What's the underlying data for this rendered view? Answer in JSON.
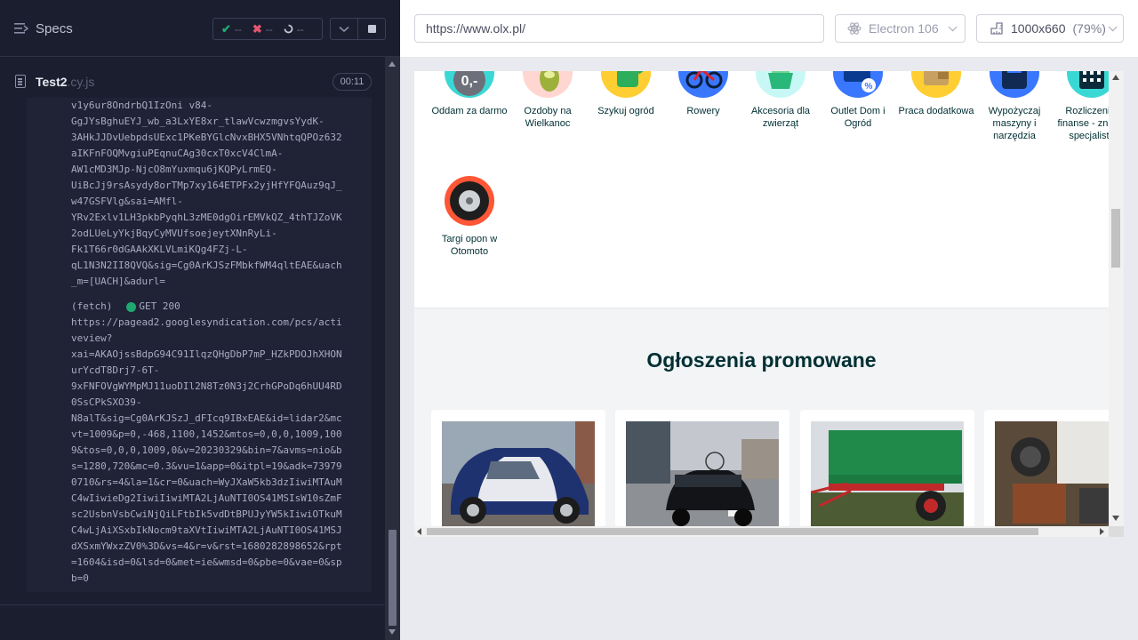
{
  "reporter": {
    "title": "Specs",
    "stats": {
      "passed": "--",
      "failed": "--",
      "pending": "--"
    },
    "spec_file": {
      "name": "Test2",
      "ext": ".cy.js",
      "duration": "00:11"
    },
    "log_lines": [
      "v1y6ur8OndrbQ1IzOni v84-",
      "GgJYsBghuEYJ_wb_a3LxYE8xr_tlawVcwzmgvsYydK-",
      "3AHkJJDvUebpdsUExc1PKeBYGlcNvxBHX5VNhtqQPOz632",
      "aIKFnFOQMvgiuPEqnuCAg30cxT0xcV4ClmA-",
      "AW1cMD3MJp-NjcO8mYuxmqu6jKQPyLrmEQ-",
      "UiBcJj9rsAsydy8orTMp7xy164ETPFx2yjHfYFQAuz9qJ_",
      "w47GSFVlg&sai=AMfl-",
      "YRv2Exlv1LH3pkbPyqhL3zME0dgOirEMVkQZ_4thTJZoVK",
      "2odLUeLyYkjBqyCyMVUfsoejeytXNnRyLi-",
      "Fk1T66r0dGAAkXKLVLmiKQg4FZj-L-",
      "qL1N3N2II8QVQ&sig=Cg0ArKJSzFMbkfWM4qltEAE&uach",
      "_m=[UACH]&adurl="
    ],
    "fetch": {
      "kind": "(fetch)",
      "method": "GET",
      "status": "200"
    },
    "fetch_lines": [
      "https://pagead2.googlesyndication.com/pcs/acti",
      "veview?",
      "xai=AKAOjssBdpG94C91IlqzQHgDbP7mP_HZkPDOJhXHON",
      "urYcdT8Drj7-6T-",
      "9xFNFOVgWYMpMJ11uoDIl2N8Tz0N3j2CrhGPoDq6hUU4RD",
      "0SsCPkSXO39-",
      "N8alT&sig=Cg0ArKJSzJ_dFIcq9IBxEAE&id=lidar2&mc",
      "vt=1009&p=0,-468,1100,1452&mtos=0,0,0,1009,100",
      "9&tos=0,0,0,1009,0&v=20230329&bin=7&avms=nio&b",
      "s=1280,720&mc=0.3&vu=1&app=0&itpl=19&adk=73979",
      "0710&rs=4&la=1&cr=0&uach=WyJXaW5kb3dzIiwiMTAuM",
      "C4wIiwieDg2IiwiIiwiMTA2LjAuNTI0OS41MSIsW10sZmF",
      "sc2UsbnVsbCwiNjQiLFtbIk5vdDtBPUJyYW5kIiwiOTkuM",
      "C4wLjAiXSxbIkNocm9taXVtIiwiMTA2LjAuNTI0OS41MSJ",
      "dXSxmYWxzZV0%3D&vs=4&r=v&rst=1680282898652&rpt",
      "=1604&isd=0&lsd=0&met=ie&wmsd=0&pbe=0&vae=0&sp",
      "b=0"
    ]
  },
  "aut": {
    "url": "https://www.olx.pl/",
    "browser": "Electron 106",
    "viewport": "1000x660",
    "zoom": "(79%)"
  },
  "page": {
    "categories": [
      {
        "label": "Oddam za darmo",
        "color": "#3ad8d5",
        "icon": "zero-price-icon"
      },
      {
        "label": "Ozdoby na Wielkanoc",
        "color": "#ffd6d0",
        "icon": "easter-egg-icon"
      },
      {
        "label": "Szykuj ogród",
        "color": "#ffce32",
        "icon": "watering-can-icon"
      },
      {
        "label": "Rowery",
        "color": "#3a77ff",
        "icon": "bicycle-icon"
      },
      {
        "label": "Akcesoria dla zwierząt",
        "color": "#c8f8f6",
        "icon": "pet-bowl-icon"
      },
      {
        "label": "Outlet Dom i Ogród",
        "color": "#3a77ff",
        "icon": "outlet-sofa-icon"
      },
      {
        "label": "Praca dodatkowa",
        "color": "#ffce32",
        "icon": "wallet-icon"
      },
      {
        "label": "Wypożyczaj maszyny i narzędzia",
        "color": "#3a77ff",
        "icon": "machine-icon"
      },
      {
        "label": "Rozliczenia, finanse - znajdź specjalistę",
        "color": "#3ad8d5",
        "icon": "calculator-icon"
      },
      {
        "label": "Targi opon w Otomoto",
        "color": "#ff5636",
        "icon": "tire-icon"
      }
    ],
    "promo_title": "Ogłoszenia promowane",
    "cards": [
      {
        "icon": "smart-car-photo"
      },
      {
        "icon": "black-sedan-photo"
      },
      {
        "icon": "green-trailer-photo"
      },
      {
        "icon": "engine-parts-photo"
      }
    ]
  }
}
